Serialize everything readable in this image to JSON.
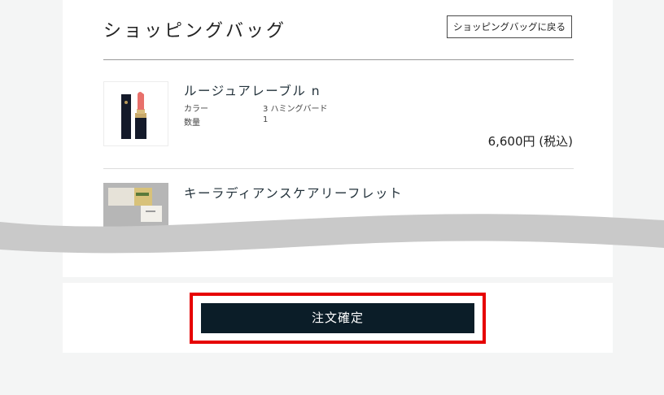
{
  "header": {
    "title": "ショッピングバッグ",
    "back_label": "ショッピングバッグに戻る"
  },
  "items": [
    {
      "name": "ルージュアレーブル n",
      "color_label": "カラー",
      "color_value": "3 ハミングバード",
      "qty_label": "数量",
      "qty_value": "1",
      "price": "6,600円 (税込)",
      "thumbnail": "lipstick-image"
    },
    {
      "name": "キーラディアンスケアリーフレット",
      "thumbnail": "leaflet-image"
    }
  ],
  "footer": {
    "confirm_label": "注文確定"
  },
  "colors": {
    "accent_highlight": "#e60000",
    "button_bg": "#0b1d28"
  }
}
